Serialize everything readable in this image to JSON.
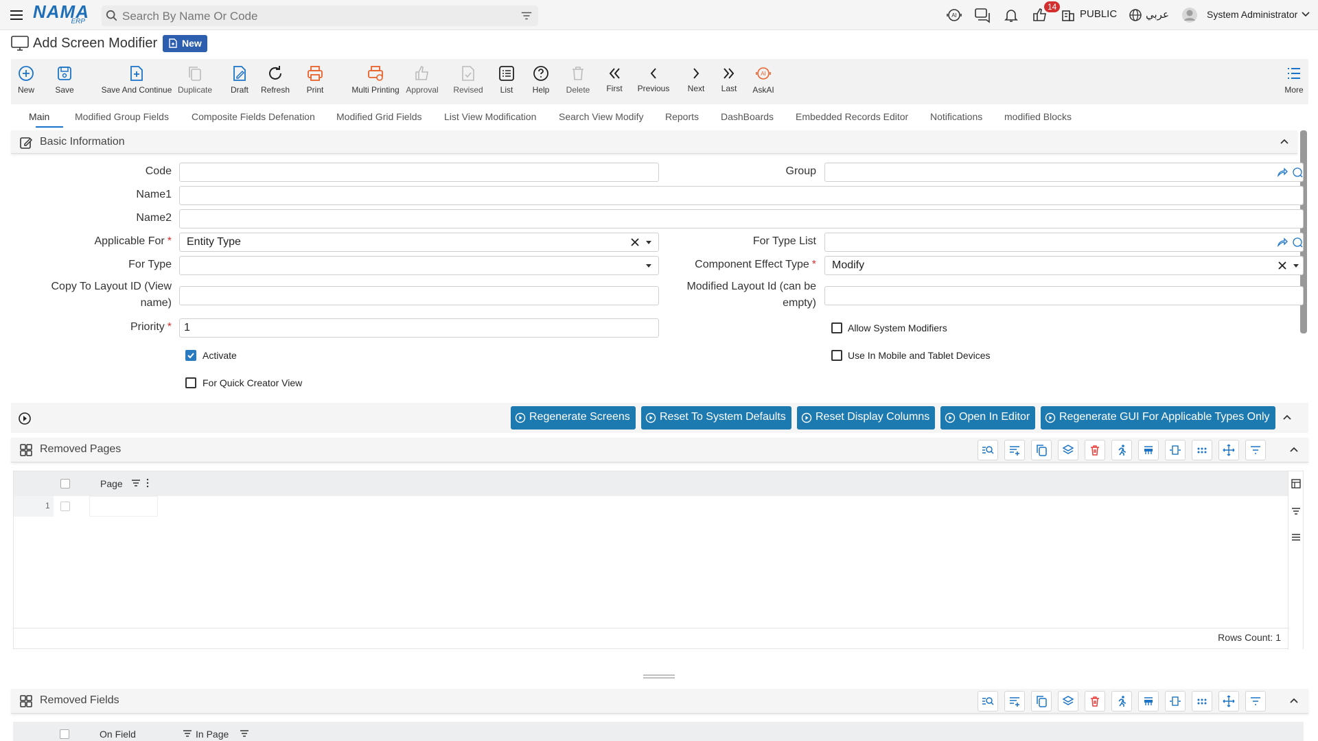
{
  "topbar": {
    "logo_text": "NAMA",
    "logo_sub": "ERP",
    "search_placeholder": "Search By Name Or Code",
    "notification_count": "14",
    "company": "PUBLIC",
    "language": "عربي",
    "user": "System Administrator",
    "brand_color": "#1e6fb8"
  },
  "page": {
    "title": "Add Screen Modifier",
    "status_badge": "New"
  },
  "toolbar": {
    "new": "New",
    "save": "Save",
    "save_continue": "Save And Continue",
    "duplicate": "Duplicate",
    "draft": "Draft",
    "refresh": "Refresh",
    "print": "Print",
    "multi_printing": "Multi Printing",
    "approval": "Approval",
    "revised": "Revised",
    "list": "List",
    "help": "Help",
    "delete": "Delete",
    "first": "First",
    "previous": "Previous",
    "next": "Next",
    "last": "Last",
    "askai": "AskAI",
    "more": "More"
  },
  "tabs": [
    "Main",
    "Modified Group Fields",
    "Composite Fields Defenation",
    "Modified Grid Fields",
    "List View Modification",
    "Search View Modify",
    "Reports",
    "DashBoards",
    "Embedded Records Editor",
    "Notifications",
    "modified Blocks"
  ],
  "basic_info": {
    "title": "Basic Information",
    "code_label": "Code",
    "code_value": "",
    "group_label": "Group",
    "group_value": "",
    "name1_label": "Name1",
    "name1_value": "",
    "name2_label": "Name2",
    "name2_value": "",
    "applicable_for_label": "Applicable For",
    "applicable_for_value": "Entity Type",
    "for_type_list_label": "For Type List",
    "for_type_list_value": "",
    "for_type_label": "For Type",
    "for_type_value": "",
    "component_effect_label": "Component Effect Type",
    "component_effect_value": "Modify",
    "copy_layout_label_1": "Copy To Layout ID (View",
    "copy_layout_label_2": "name)",
    "copy_layout_value": "",
    "modified_layout_label_1": "Modified Layout Id (can be",
    "modified_layout_label_2": "empty)",
    "modified_layout_value": "",
    "priority_label": "Priority",
    "priority_value": "1",
    "required_mark": "*",
    "allow_system_modifiers": "Allow System Modifiers",
    "activate": "Activate",
    "use_in_mobile": "Use In Mobile and Tablet Devices",
    "quick_creator": "For Quick Creator View",
    "activate_checked": true,
    "allow_system_modifiers_checked": false,
    "use_in_mobile_checked": false,
    "quick_creator_checked": false
  },
  "actions": {
    "regenerate_screens": "Regenerate Screens",
    "reset_defaults": "Reset To System Defaults",
    "reset_columns": "Reset Display Columns",
    "open_editor": "Open In Editor",
    "regenerate_gui": "Regenerate GUI For Applicable Types Only",
    "button_color": "#1d7ab1"
  },
  "removed_pages": {
    "title": "Removed Pages",
    "columns": [
      "Page"
    ],
    "rows": [
      {
        "index": "1",
        "page": ""
      }
    ],
    "rows_count_label": "Rows Count: 1"
  },
  "removed_fields": {
    "title": "Removed Fields",
    "columns": [
      "On Field",
      "In Page"
    ]
  }
}
